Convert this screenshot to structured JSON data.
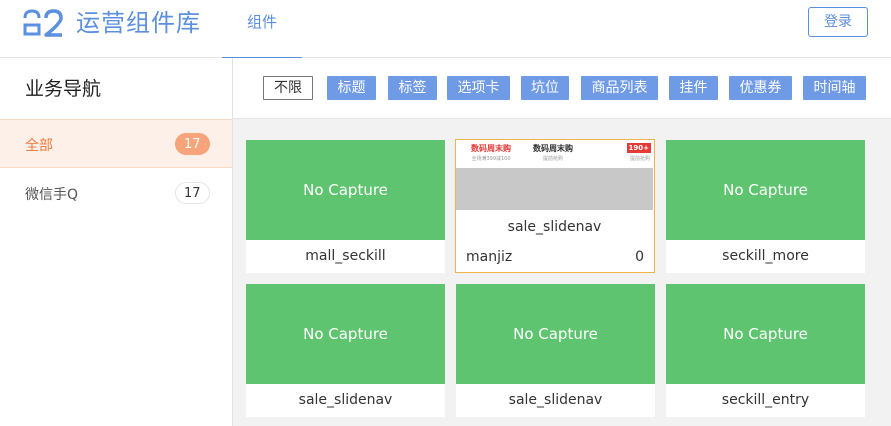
{
  "header": {
    "app_title": "运营组件库",
    "nav_tab": "组件",
    "login_label": "登录",
    "accent_color": "#5b8fe0"
  },
  "sidebar": {
    "title": "业务导航",
    "items": [
      {
        "label": "全部",
        "count": "17",
        "active": true
      },
      {
        "label": "微信手Q",
        "count": "17",
        "active": false
      }
    ]
  },
  "filters": [
    "不限",
    "标题",
    "标签",
    "选项卡",
    "坑位",
    "商品列表",
    "挂件",
    "优惠券",
    "时间轴"
  ],
  "cards": [
    {
      "thumb": "No Capture",
      "name": "mall_seckill"
    },
    {
      "name": "sale_slidenav",
      "author": "manjiz",
      "likes": "0",
      "preview": [
        {
          "title": "数码周末购",
          "sub": "全场满399减100"
        },
        {
          "title": "数码周末购",
          "sub": "提前抢购"
        },
        {
          "title": "",
          "sub": "提前抢购",
          "badge": "190+"
        }
      ]
    },
    {
      "thumb": "No Capture",
      "name": "seckill_more"
    },
    {
      "thumb": "No Capture",
      "name": "sale_slidenav"
    },
    {
      "thumb": "No Capture",
      "name": "sale_slidenav"
    },
    {
      "thumb": "No Capture",
      "name": "seckill_entry"
    }
  ],
  "colors": {
    "active_orange": "#f07b3f",
    "filter_blue": "#6f9ae6",
    "thumb_green": "#5fc46f",
    "highlight_border": "#f0b447"
  }
}
